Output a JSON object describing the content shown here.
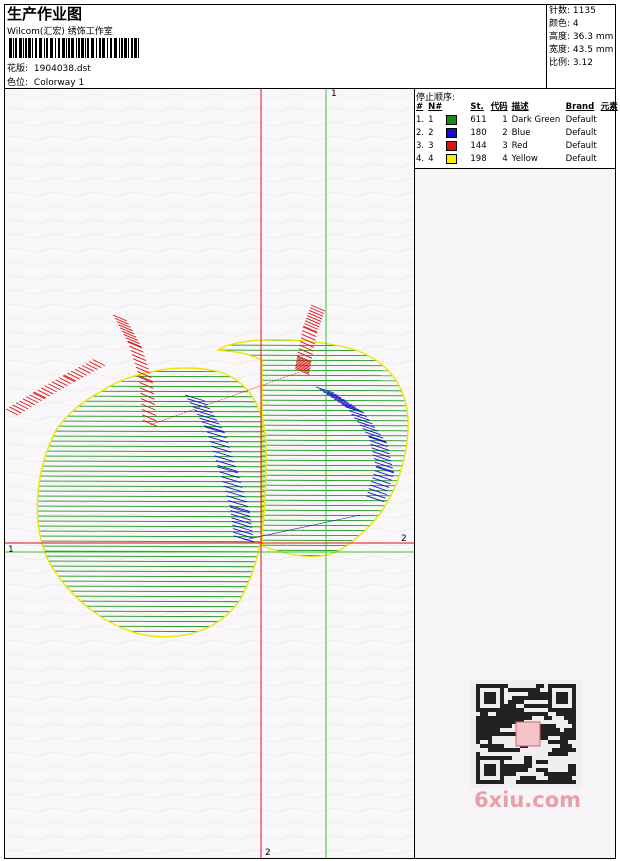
{
  "header": {
    "title": "生产作业图",
    "studio": "Wilcom(汇宏) 绣饰工作室",
    "design_label": "花版:",
    "design_file": "1904038.dst",
    "colorway_label": "色位:",
    "colorway": "Colorway 1"
  },
  "stats": [
    {
      "label": "针数:",
      "value": "1135"
    },
    {
      "label": "颜色:",
      "value": "4"
    },
    {
      "label": "高度:",
      "value": "36.3 mm"
    },
    {
      "label": "宽度:",
      "value": "43.5 mm"
    },
    {
      "label": "比例:",
      "value": "3.12"
    }
  ],
  "stop_sequence": {
    "title": "停止顺序:",
    "columns": [
      "#",
      "N#",
      "St.",
      "代码",
      "描述",
      "Brand",
      "元素"
    ],
    "rows": [
      {
        "idx": "1.",
        "n": "1",
        "color": "#1a8a1a",
        "st": "611",
        "code": "1",
        "desc": "Dark Green",
        "brand": "Default"
      },
      {
        "idx": "2.",
        "n": "2",
        "color": "#1010c8",
        "st": "180",
        "code": "2",
        "desc": "Blue",
        "brand": "Default"
      },
      {
        "idx": "3.",
        "n": "3",
        "color": "#e01010",
        "st": "144",
        "code": "3",
        "desc": "Red",
        "brand": "Default"
      },
      {
        "idx": "4.",
        "n": "4",
        "color": "#f0f000",
        "st": "198",
        "code": "4",
        "desc": "Yellow",
        "brand": "Default"
      }
    ]
  },
  "axes": {
    "green_top": "1",
    "green_left": "1",
    "red_right": "2",
    "red_bottom": "2"
  },
  "watermark": "6xiu.com"
}
